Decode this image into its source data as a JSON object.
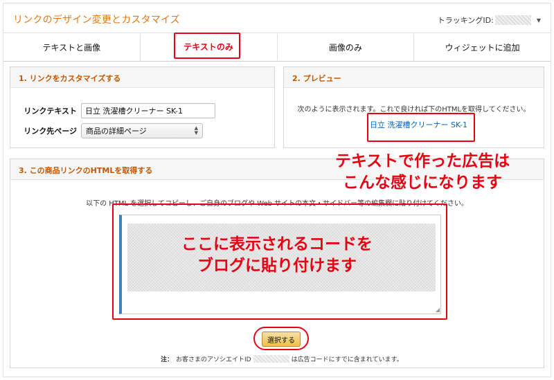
{
  "header": {
    "title": "リンクのデザイン変更とカスタマイズ",
    "tracking_label": "トラッキングID:"
  },
  "tabs": [
    {
      "label": "テキストと画像"
    },
    {
      "label": "テキストのみ"
    },
    {
      "label": "画像のみ"
    },
    {
      "label": "ウィジェットに追加"
    }
  ],
  "customize": {
    "heading": "1. リンクをカスタマイズする",
    "link_text_label": "リンクテキスト",
    "link_text_value": "日立 洗濯槽クリーナー SK-1",
    "link_dest_label": "リンク先ページ",
    "link_dest_value": "商品の詳細ページ"
  },
  "preview": {
    "heading": "2. プレビュー",
    "instruction": "次のように表示されます。これで良ければ下のHTMLを取得してください。",
    "link_text": "日立 洗濯槽クリーナー SK-1"
  },
  "html_section": {
    "heading": "3. この商品リンクのHTMLを取得する",
    "instruction": "以下の HTML を選択してコピーし、ご自身のブログや Web サイトの本文・サイドバー等の編集欄に貼り付けてください。",
    "select_button": "選択する",
    "note_label": "注：",
    "note_text_a": "お客さまのアソシエイトID",
    "note_text_b": "は広告コードにすでに含まれています。"
  },
  "annotations": {
    "callout_preview": [
      "テキストで作った広告は",
      "こんな感じになります"
    ],
    "callout_code": [
      "ここに表示されるコードを",
      "ブログに貼り付けます"
    ],
    "highlight_color": "#e60012"
  },
  "colors": {
    "accent": "#e47911",
    "heading": "#c45500",
    "link": "#0066c0",
    "button": "#f0c14b"
  }
}
